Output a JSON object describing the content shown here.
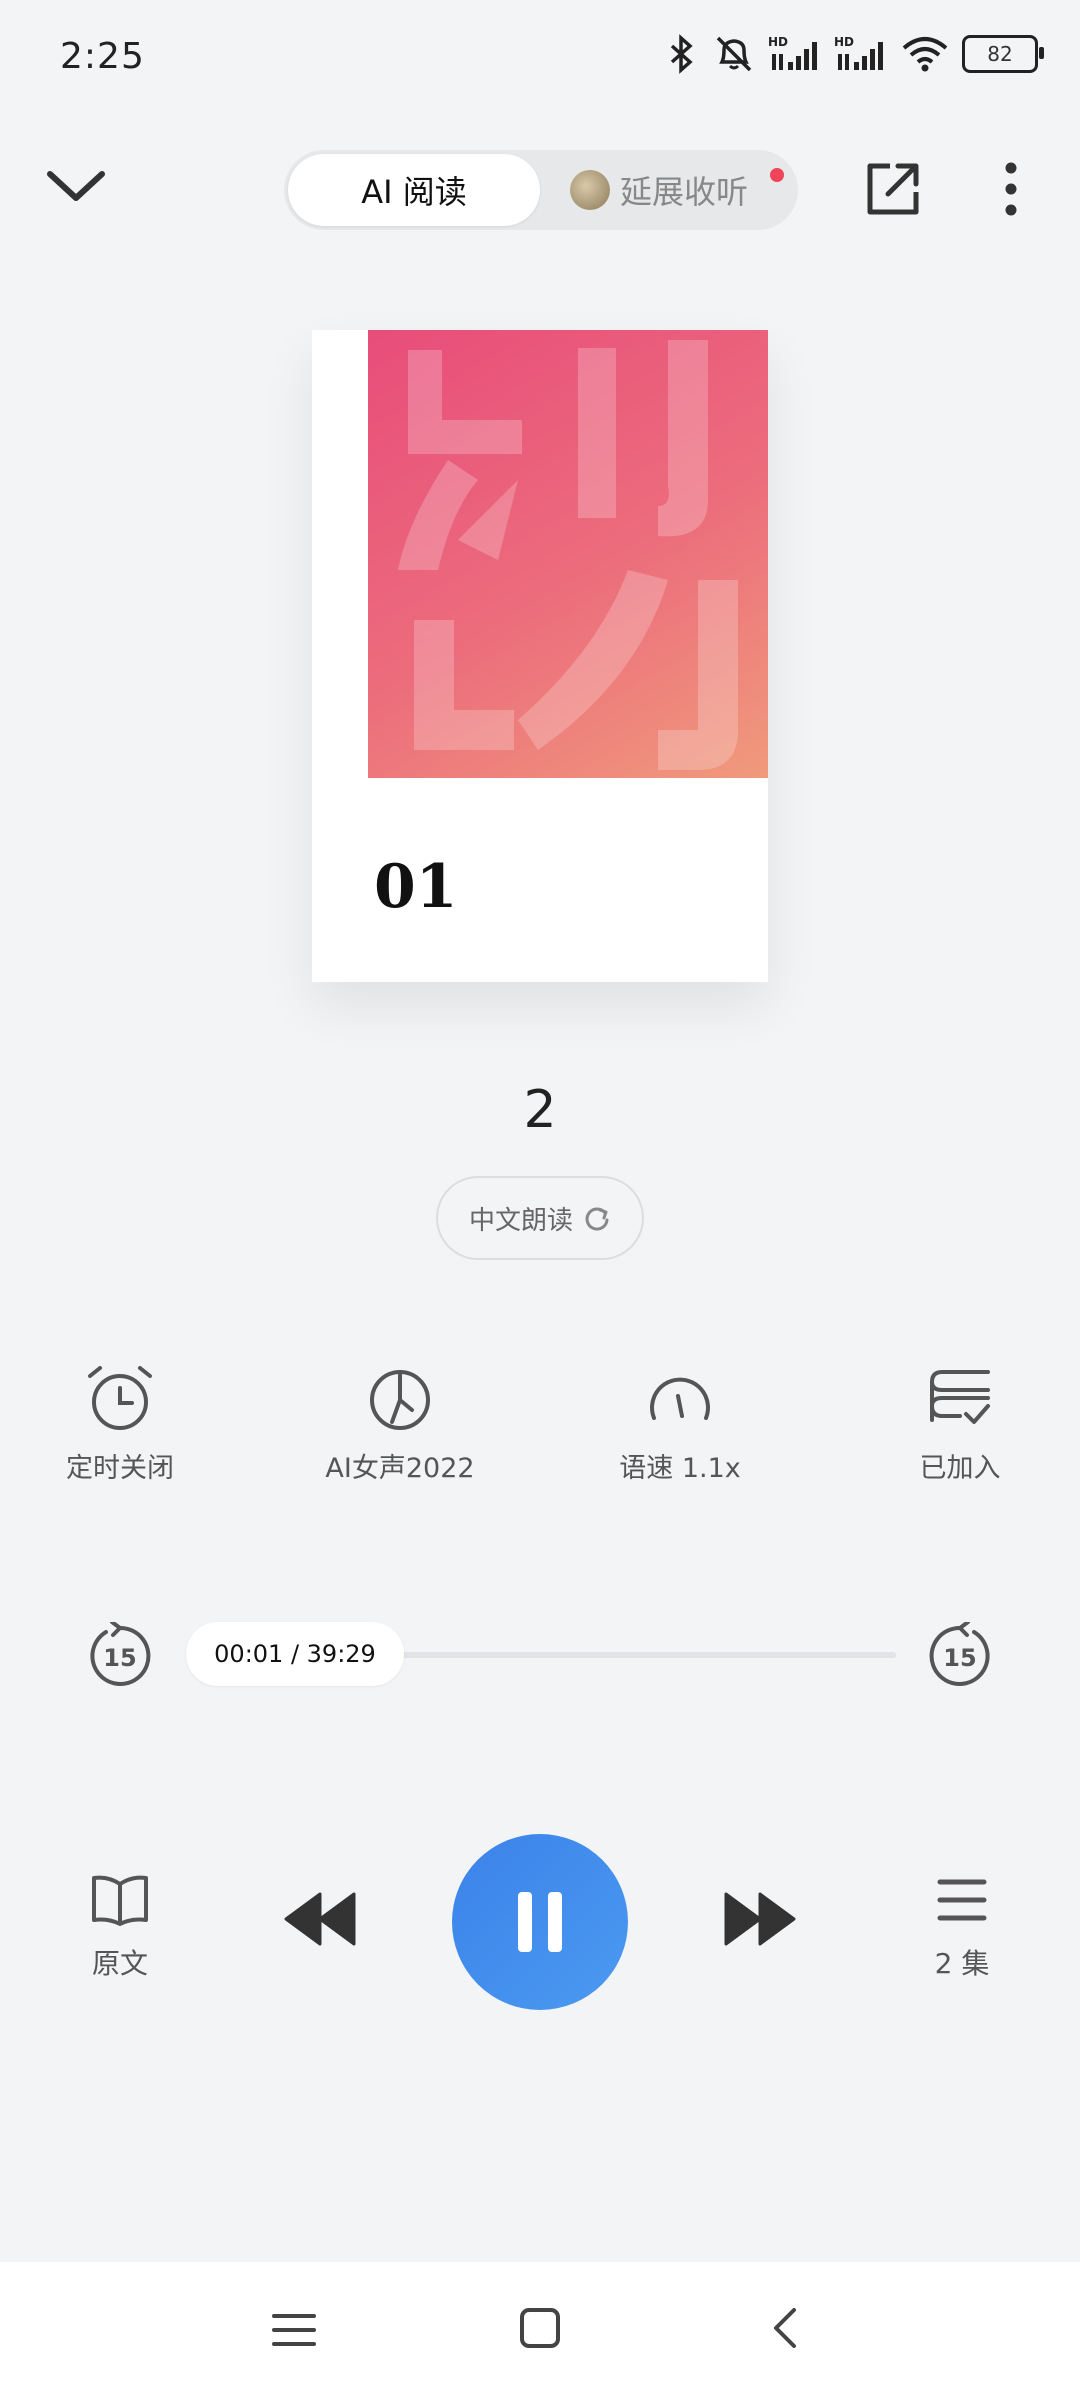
{
  "status_bar": {
    "time": "2:25",
    "battery": "82",
    "icons": [
      "bluetooth-icon",
      "mute-icon",
      "signal-icon",
      "signal-icon",
      "wifi-icon",
      "battery-icon"
    ]
  },
  "header": {
    "tab_ai_label": "AI 阅读",
    "tab_extended_label": "延展收听",
    "icons": [
      "chevron-down-icon",
      "share-icon",
      "more-vert-icon"
    ]
  },
  "cover": {
    "episode_number": "01"
  },
  "track": {
    "title": "2",
    "language_button": "中文朗读"
  },
  "functions": [
    {
      "label": "定时关闭",
      "icon": "alarm-clock-icon"
    },
    {
      "label": "AI女声2022",
      "icon": "voice-icon"
    },
    {
      "label": "语速 1.1x",
      "icon": "speed-gauge-icon"
    },
    {
      "label": "已加入",
      "icon": "bookshelf-added-icon"
    }
  ],
  "progress": {
    "time_text": "00:01 / 39:29",
    "current_seconds": 1,
    "total_seconds": 2369,
    "skip_seconds": "15"
  },
  "controls": {
    "original_label": "原文",
    "episodes_label": "2 集",
    "state": "playing"
  },
  "colors": {
    "accent": "#3c82ea",
    "background": "#f3f4f6",
    "notification_dot": "#f0445a"
  }
}
